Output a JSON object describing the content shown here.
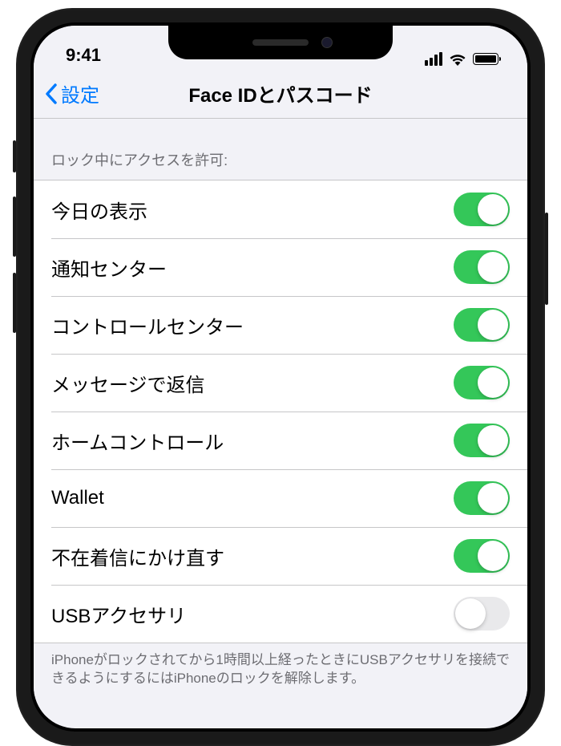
{
  "status": {
    "time": "9:41"
  },
  "nav": {
    "back_label": "設定",
    "title": "Face IDとパスコード"
  },
  "section": {
    "header": "ロック中にアクセスを許可:",
    "footer": "iPhoneがロックされてから1時間以上経ったときにUSBアクセサリを接続できるようにするにはiPhoneのロックを解除します。"
  },
  "items": [
    {
      "label": "今日の表示",
      "on": true,
      "name": "today-view"
    },
    {
      "label": "通知センター",
      "on": true,
      "name": "notification-center"
    },
    {
      "label": "コントロールセンター",
      "on": true,
      "name": "control-center"
    },
    {
      "label": "メッセージで返信",
      "on": true,
      "name": "reply-with-message"
    },
    {
      "label": "ホームコントロール",
      "on": true,
      "name": "home-control"
    },
    {
      "label": "Wallet",
      "on": true,
      "name": "wallet"
    },
    {
      "label": "不在着信にかけ直す",
      "on": true,
      "name": "return-missed-calls"
    },
    {
      "label": "USBアクセサリ",
      "on": false,
      "name": "usb-accessories"
    }
  ]
}
